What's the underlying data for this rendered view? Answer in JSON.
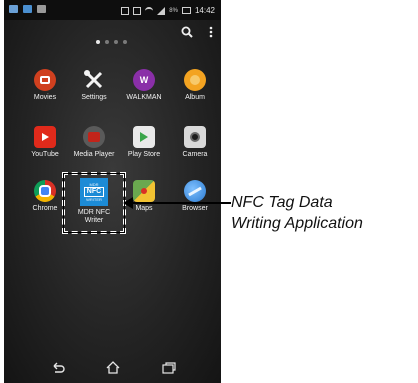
{
  "status_bar": {
    "battery_percent": "8%",
    "time": "14:42"
  },
  "apps": {
    "row1": [
      {
        "label": "Movies",
        "icon": "movies-icon",
        "color": "#d0401f"
      },
      {
        "label": "Settings",
        "icon": "wrench-screwdriver-icon",
        "color": "#ffffff"
      },
      {
        "label": "WALKMAN",
        "icon": "walkman-icon",
        "color": "#8a2fa8"
      },
      {
        "label": "Album",
        "icon": "album-icon",
        "color": "#f3a321"
      }
    ],
    "row2": [
      {
        "label": "YouTube",
        "icon": "youtube-icon",
        "color": "#e02a1b"
      },
      {
        "label": "Media Player",
        "icon": "media-player-icon",
        "color": "#c2241a"
      },
      {
        "label": "Play Store",
        "icon": "play-store-icon",
        "color": "#e9e9e9"
      },
      {
        "label": "Camera",
        "icon": "camera-icon",
        "color": "#d9d9d9"
      }
    ],
    "row3": [
      {
        "label": "Chrome",
        "icon": "chrome-icon",
        "color": "#3b9a3b"
      },
      {
        "label": "MDR NFC Writer",
        "icon": "mdr-nfc-writer-icon",
        "color": "#1c8bd6",
        "tile_lines": [
          "MDR",
          "NFC",
          "WRITER"
        ]
      },
      {
        "label": "Maps",
        "icon": "maps-icon",
        "color": "#6aa84f"
      },
      {
        "label": "Browser",
        "icon": "browser-icon",
        "color": "#2a7ad0"
      }
    ]
  },
  "callout": {
    "line1": "NFC Tag Data",
    "line2": "Writing Application"
  }
}
